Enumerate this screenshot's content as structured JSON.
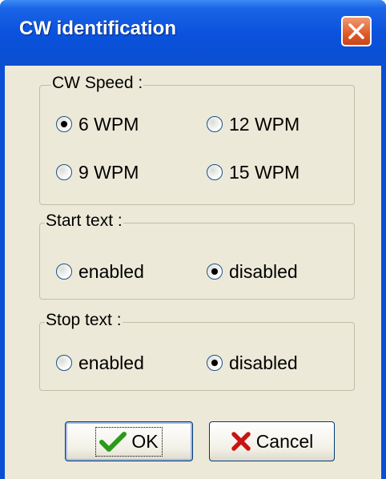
{
  "window": {
    "title": "CW identification"
  },
  "cw_speed": {
    "legend": "CW Speed :",
    "options": [
      {
        "label": "6 WPM",
        "checked": true
      },
      {
        "label": "12 WPM",
        "checked": false
      },
      {
        "label": "9 WPM",
        "checked": false
      },
      {
        "label": "15 WPM",
        "checked": false
      }
    ]
  },
  "start_text": {
    "legend": "Start text :",
    "options": [
      {
        "label": "enabled",
        "checked": false
      },
      {
        "label": "disabled",
        "checked": true
      }
    ]
  },
  "stop_text": {
    "legend": "Stop text :",
    "options": [
      {
        "label": "enabled",
        "checked": false
      },
      {
        "label": "disabled",
        "checked": true
      }
    ]
  },
  "buttons": {
    "ok_label": "OK",
    "cancel_label": "Cancel"
  },
  "colors": {
    "titlebar": "#0a52dc",
    "close": "#e05a28",
    "ok_icon": "#2a9a1a",
    "cancel_icon": "#c81414"
  },
  "icons": {
    "close": "close-icon",
    "ok": "checkmark-icon",
    "cancel": "x-mark-icon"
  }
}
